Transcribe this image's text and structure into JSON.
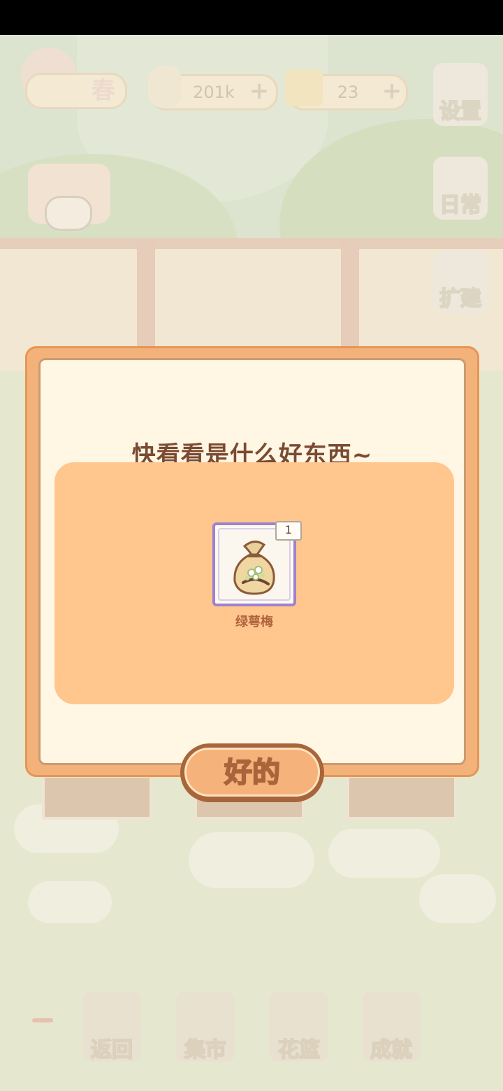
{
  "hud": {
    "season_label": "春",
    "fish_count": "201k",
    "cheese_count": "23"
  },
  "side_menu": {
    "settings_label": "设置",
    "daily_label": "日常",
    "expand_label": "扩建"
  },
  "bottom_menu": {
    "back_label": "返回",
    "market_label": "集市",
    "basket_label": "花篮",
    "achievements_label": "成就"
  },
  "dialog": {
    "title": "快看看是什么好东西~",
    "reward": {
      "name": "绿萼梅",
      "count": "1",
      "icon": "seed-bag-icon"
    },
    "confirm_label": "好的"
  },
  "colors": {
    "dialog_border": "#f4b27b",
    "dialog_bg": "#fff6e3",
    "panel_bg": "#ffc68e",
    "item_frame": "#9d82cf",
    "title_text": "#7a4a32",
    "button_face": "#f6b27b"
  }
}
